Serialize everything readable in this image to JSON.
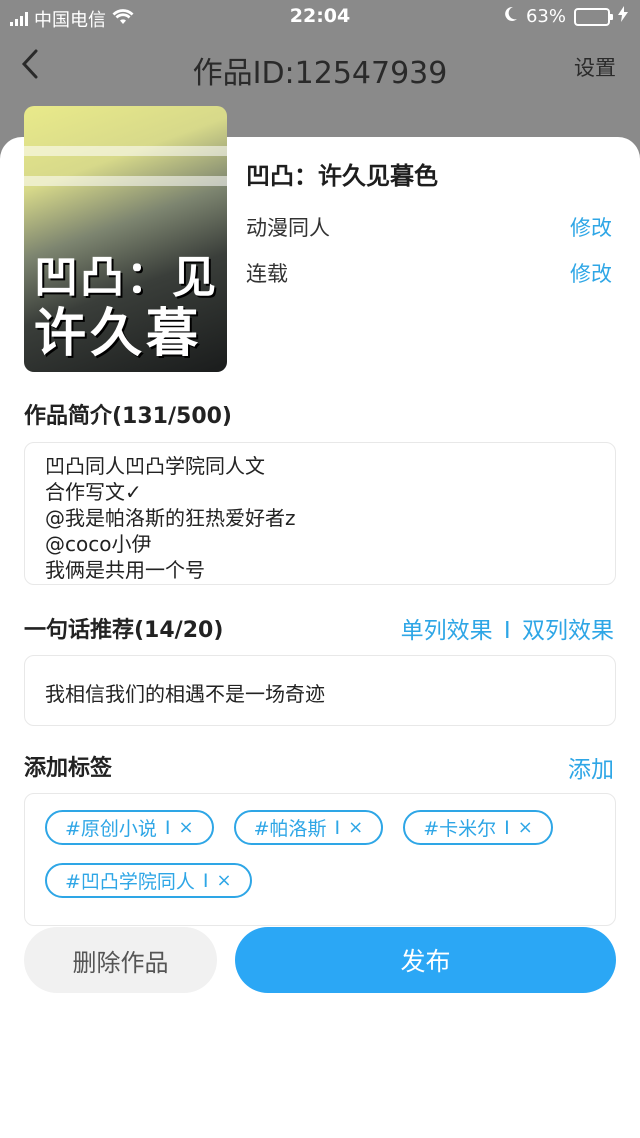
{
  "status_bar": {
    "carrier": "中国电信",
    "time": "22:04",
    "battery": "63%",
    "battery_level": 0.63
  },
  "nav": {
    "back_icon": "chevron-left-icon",
    "title": "作品ID:12547939",
    "settings_label": "设置"
  },
  "work": {
    "cover_text_line1": "凹凸：见",
    "cover_text_line2": "许久暮色",
    "title": "凹凸：许久见暮色",
    "category": "动漫同人",
    "category_action": "修改",
    "status": "连载",
    "status_action": "修改"
  },
  "intro": {
    "label": "作品简介(131/500)",
    "text": "凹凸同人凹凸学院同人文\n合作写文✓\n@我是帕洛斯的狂热爱好者z\n@coco小伊\n我俩是共用一个号"
  },
  "recommend": {
    "label": "一句话推荐(14/20)",
    "single_label": "单列效果",
    "divider": "I",
    "double_label": "双列效果",
    "text": "我相信我们的相遇不是一场奇迹"
  },
  "tags": {
    "label": "添加标签",
    "add_label": "添加",
    "items": [
      {
        "text": "#原创小说",
        "sep": "I",
        "remove": "×"
      },
      {
        "text": "#帕洛斯",
        "sep": "I",
        "remove": "×"
      },
      {
        "text": "#卡米尔",
        "sep": "I",
        "remove": "×"
      },
      {
        "text": "#凹凸学院同人",
        "sep": "I",
        "remove": "×"
      }
    ]
  },
  "actions": {
    "delete_label": "删除作品",
    "publish_label": "发布"
  },
  "colors": {
    "accent": "#2ea6e6",
    "publish": "#2ba7f5",
    "battery": "#4cd964"
  }
}
